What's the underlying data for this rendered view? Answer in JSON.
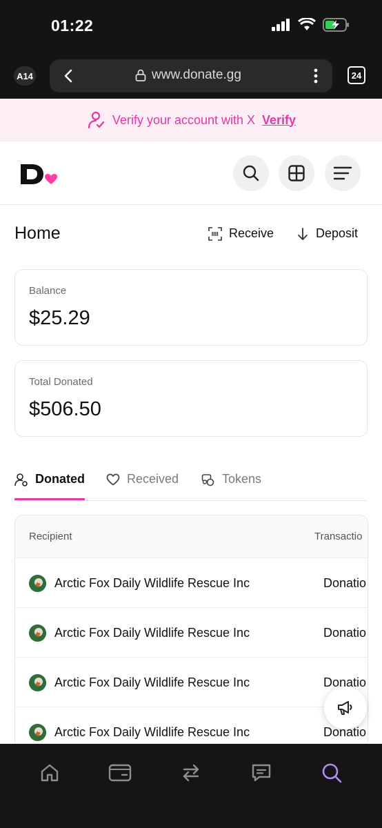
{
  "status_bar": {
    "time": "01:22"
  },
  "browser": {
    "profile_badge": "A14",
    "url": "www.donate.gg",
    "tab_count": "24"
  },
  "banner": {
    "message": "Verify your account with X",
    "link_label": "Verify"
  },
  "header": {
    "logo_text": "D"
  },
  "home": {
    "title": "Home",
    "receive_label": "Receive",
    "deposit_label": "Deposit"
  },
  "cards": [
    {
      "label": "Balance",
      "value": "$25.29"
    },
    {
      "label": "Total Donated",
      "value": "$506.50"
    }
  ],
  "tabs": [
    {
      "label": "Donated",
      "active": true
    },
    {
      "label": "Received",
      "active": false
    },
    {
      "label": "Tokens",
      "active": false
    }
  ],
  "table": {
    "columns": [
      "Recipient",
      "Transactio"
    ],
    "rows": [
      {
        "recipient": "Arctic Fox Daily Wildlife Rescue Inc",
        "type": "Donatio"
      },
      {
        "recipient": "Arctic Fox Daily Wildlife Rescue Inc",
        "type": "Donatio"
      },
      {
        "recipient": "Arctic Fox Daily Wildlife Rescue Inc",
        "type": "Donatio"
      },
      {
        "recipient": "Arctic Fox Daily Wildlife Rescue Inc",
        "type": "Donatio"
      }
    ]
  },
  "colors": {
    "accent": "#e03aa7",
    "nav_active": "#b18cf2",
    "banner_bg": "#fdeef6"
  },
  "bottom_nav": [
    "home-icon",
    "wallet-icon",
    "transfer-icon",
    "messages-icon",
    "search-icon"
  ]
}
